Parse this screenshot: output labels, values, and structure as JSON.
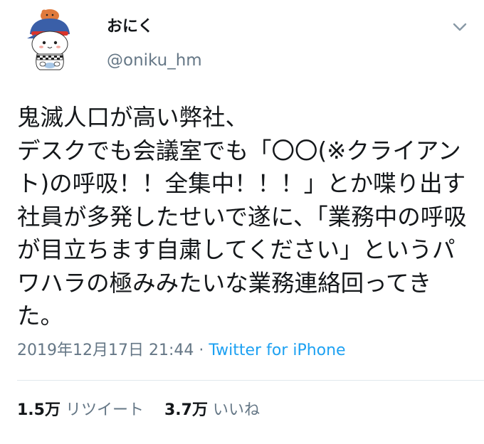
{
  "user": {
    "display_name": "おにく",
    "handle": "@oniku_hm"
  },
  "tweet": {
    "text": "鬼滅人口が高い弊社、\nデスクでも会議室でも「〇〇(※クライアント)の呼吸！！全集中！！！」とか喋り出す社員が多発したせいで遂に、「業務中の呼吸が目立ちます自粛してください」というパワハラの極みみたいな業務連絡回ってきた。",
    "timestamp": "2019年12月17日 21:44",
    "separator": " · ",
    "source": "Twitter for iPhone"
  },
  "stats": {
    "retweets_count": "1.5万",
    "retweets_label": "リツイート",
    "likes_count": "3.7万",
    "likes_label": "いいね"
  },
  "icons": {
    "caret": "chevron-down-icon",
    "avatar": "avatar"
  },
  "colors": {
    "text": "#14171a",
    "secondary": "#657786",
    "link": "#1da1f2",
    "divider": "#e1e8ed"
  }
}
